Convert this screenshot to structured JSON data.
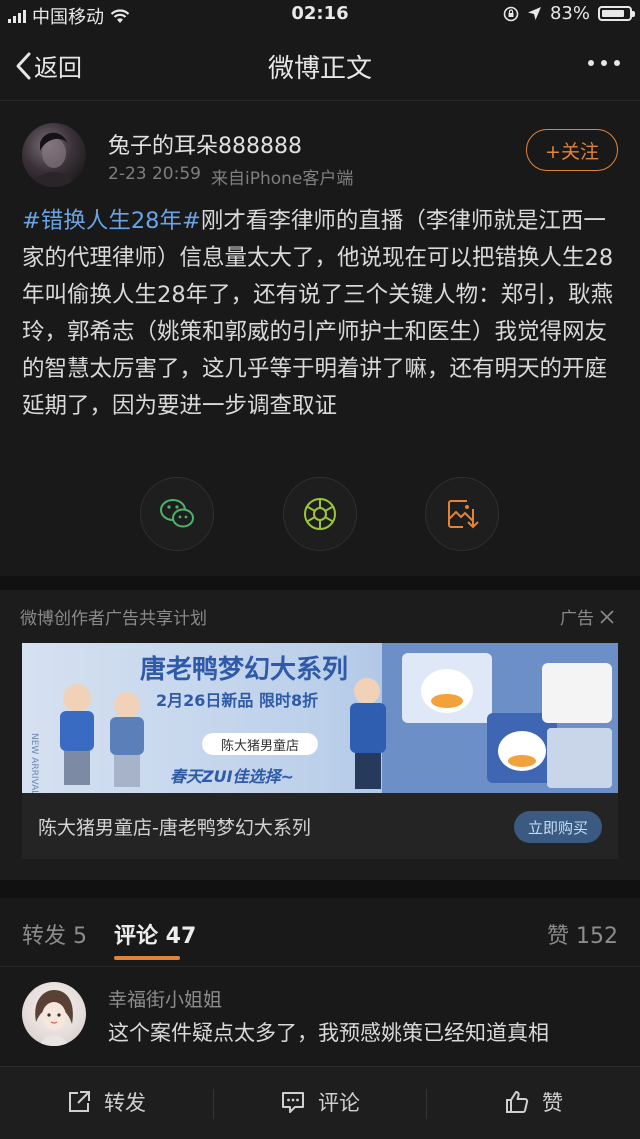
{
  "status_bar": {
    "carrier": "中国移动",
    "time": "02:16",
    "battery": "83%",
    "battery_level": 0.83
  },
  "nav": {
    "back_label": "返回",
    "title": "微博正文"
  },
  "post": {
    "username": "兔子的耳朵888888",
    "time": "2-23 20:59",
    "source": "来自iPhone客户端",
    "follow_label": "+关注",
    "hashtag": "#错换人生28年#",
    "body": "刚才看李律师的直播（李律师就是江西一家的代理律师）信息量太大了，他说现在可以把错换人生28年叫偷换人生28年了，还有说了三个关键人物：郑引，耿燕玲，郭希志（姚策和郭威的引产师护士和医生）我觉得网友的智慧太厉害了，这几乎等于明着讲了嘛，还有明天的开庭延期了，因为要进一步调查取证"
  },
  "ad": {
    "label": "微博创作者广告共享计划",
    "close_label": "广告",
    "banner_title": "唐老鸭梦幻大系列",
    "banner_promo": "2月26日新品 限时8折",
    "banner_shop": "陈大猪男童店",
    "banner_slogan": "春天ZUI佳选择~",
    "name": "陈大猪男童店-唐老鸭梦幻大系列",
    "buy_label": "立即购买"
  },
  "tabs": {
    "repost": "转发 5",
    "comment": "评论 47",
    "like": "赞 152"
  },
  "comment": {
    "name": "幸福街小姐姐",
    "text": "这个案件疑点太多了，我预感姚策已经知道真相"
  },
  "bottom_bar": {
    "repost": "转发",
    "comment": "评论",
    "like": "赞"
  },
  "colors": {
    "accent": "#e2833a",
    "link": "#6aa3e4",
    "background": "#191919"
  }
}
